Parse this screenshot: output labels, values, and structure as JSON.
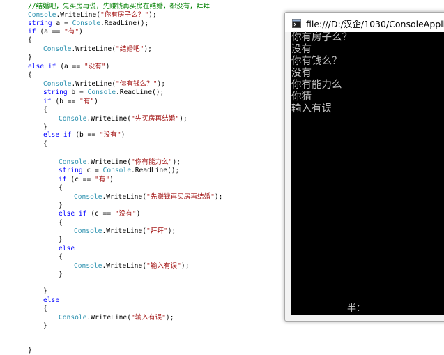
{
  "code": {
    "lines": [
      {
        "tokens": [
          {
            "t": "//结婚吧，先买房再说，先赚钱再买房在结婚，都没有，拜拜",
            "c": "cmt"
          }
        ]
      },
      {
        "tokens": [
          {
            "t": "Console",
            "c": "typ"
          },
          {
            "t": ".WriteLine(",
            "c": ""
          },
          {
            "t": "\"你有房子么？\"",
            "c": "str"
          },
          {
            "t": ");",
            "c": ""
          }
        ]
      },
      {
        "tokens": [
          {
            "t": "string",
            "c": "kw"
          },
          {
            "t": " a = ",
            "c": ""
          },
          {
            "t": "Console",
            "c": "typ"
          },
          {
            "t": ".ReadLine();",
            "c": ""
          }
        ]
      },
      {
        "tokens": [
          {
            "t": "if",
            "c": "kw"
          },
          {
            "t": " (a == ",
            "c": ""
          },
          {
            "t": "\"有\"",
            "c": "str"
          },
          {
            "t": ")",
            "c": ""
          }
        ]
      },
      {
        "tokens": [
          {
            "t": "{",
            "c": ""
          }
        ]
      },
      {
        "tokens": [
          {
            "t": "Console",
            "c": "typ"
          },
          {
            "t": ".WriteLine(",
            "c": ""
          },
          {
            "t": "\"结婚吧\"",
            "c": "str"
          },
          {
            "t": ");",
            "c": ""
          }
        ]
      },
      {
        "tokens": [
          {
            "t": "}",
            "c": ""
          }
        ]
      },
      {
        "tokens": [
          {
            "t": "else if",
            "c": "kw"
          },
          {
            "t": " (a == ",
            "c": ""
          },
          {
            "t": "\"没有\"",
            "c": "str"
          },
          {
            "t": ")",
            "c": ""
          }
        ]
      },
      {
        "tokens": [
          {
            "t": "{",
            "c": ""
          }
        ]
      },
      {
        "tokens": [
          {
            "t": "Console",
            "c": "typ"
          },
          {
            "t": ".WriteLine(",
            "c": ""
          },
          {
            "t": "\"你有钱么？\"",
            "c": "str"
          },
          {
            "t": ");",
            "c": ""
          }
        ]
      },
      {
        "tokens": [
          {
            "t": "string",
            "c": "kw"
          },
          {
            "t": " b = ",
            "c": ""
          },
          {
            "t": "Console",
            "c": "typ"
          },
          {
            "t": ".ReadLine();",
            "c": ""
          }
        ]
      },
      {
        "tokens": [
          {
            "t": "if",
            "c": "kw"
          },
          {
            "t": " (b == ",
            "c": ""
          },
          {
            "t": "\"有\"",
            "c": "str"
          },
          {
            "t": ")",
            "c": ""
          }
        ]
      },
      {
        "tokens": [
          {
            "t": "{",
            "c": ""
          }
        ]
      },
      {
        "tokens": [
          {
            "t": "Console",
            "c": "typ"
          },
          {
            "t": ".WriteLine(",
            "c": ""
          },
          {
            "t": "\"先买房再结婚\"",
            "c": "str"
          },
          {
            "t": ");",
            "c": ""
          }
        ]
      },
      {
        "tokens": [
          {
            "t": "}",
            "c": ""
          }
        ]
      },
      {
        "tokens": [
          {
            "t": "else if",
            "c": "kw"
          },
          {
            "t": " (b == ",
            "c": ""
          },
          {
            "t": "\"没有\"",
            "c": "str"
          },
          {
            "t": ")",
            "c": ""
          }
        ]
      },
      {
        "tokens": [
          {
            "t": "{",
            "c": ""
          }
        ]
      },
      {
        "tokens": [
          {
            "t": "Console",
            "c": "typ"
          },
          {
            "t": ".WriteLine(",
            "c": ""
          },
          {
            "t": "\"你有能力么\"",
            "c": "str"
          },
          {
            "t": ");",
            "c": ""
          }
        ]
      },
      {
        "tokens": [
          {
            "t": "string",
            "c": "kw"
          },
          {
            "t": " c = ",
            "c": ""
          },
          {
            "t": "Console",
            "c": "typ"
          },
          {
            "t": ".ReadLine();",
            "c": ""
          }
        ]
      },
      {
        "tokens": [
          {
            "t": "if",
            "c": "kw"
          },
          {
            "t": " (c == ",
            "c": ""
          },
          {
            "t": "\"有\"",
            "c": "str"
          },
          {
            "t": ")",
            "c": ""
          }
        ]
      },
      {
        "tokens": [
          {
            "t": "{",
            "c": ""
          }
        ]
      },
      {
        "tokens": [
          {
            "t": "Console",
            "c": "typ"
          },
          {
            "t": ".WriteLine(",
            "c": ""
          },
          {
            "t": "\"先赚钱再买房再结婚\"",
            "c": "str"
          },
          {
            "t": ");",
            "c": ""
          }
        ]
      },
      {
        "tokens": [
          {
            "t": "}",
            "c": ""
          }
        ]
      },
      {
        "tokens": [
          {
            "t": "else if",
            "c": "kw"
          },
          {
            "t": " (c == ",
            "c": ""
          },
          {
            "t": "\"没有\"",
            "c": "str"
          },
          {
            "t": ")",
            "c": ""
          }
        ]
      },
      {
        "tokens": [
          {
            "t": "{",
            "c": ""
          }
        ]
      },
      {
        "tokens": [
          {
            "t": "Console",
            "c": "typ"
          },
          {
            "t": ".WriteLine(",
            "c": ""
          },
          {
            "t": "\"拜拜\"",
            "c": "str"
          },
          {
            "t": ");",
            "c": ""
          }
        ]
      },
      {
        "tokens": [
          {
            "t": "}",
            "c": ""
          }
        ]
      },
      {
        "tokens": [
          {
            "t": "else",
            "c": "kw"
          }
        ]
      },
      {
        "tokens": [
          {
            "t": "{",
            "c": ""
          }
        ]
      },
      {
        "tokens": [
          {
            "t": "Console",
            "c": "typ"
          },
          {
            "t": ".WriteLine(",
            "c": ""
          },
          {
            "t": "\"输入有误\"",
            "c": "str"
          },
          {
            "t": ");",
            "c": ""
          }
        ]
      },
      {
        "tokens": [
          {
            "t": "}",
            "c": ""
          }
        ]
      },
      {
        "tokens": [
          {
            "t": "}",
            "c": ""
          }
        ]
      },
      {
        "tokens": [
          {
            "t": "else",
            "c": "kw"
          }
        ]
      },
      {
        "tokens": [
          {
            "t": "{",
            "c": ""
          }
        ]
      },
      {
        "tokens": [
          {
            "t": "Console",
            "c": "typ"
          },
          {
            "t": ".WriteLine(",
            "c": ""
          },
          {
            "t": "\"输入有误\"",
            "c": "str"
          },
          {
            "t": ");",
            "c": ""
          }
        ]
      },
      {
        "tokens": [
          {
            "t": "}",
            "c": ""
          }
        ]
      },
      {
        "tokens": [
          {
            "t": "}",
            "c": ""
          }
        ]
      }
    ]
  },
  "console_window": {
    "title": "file:///D:/汉企/1030/ConsoleApplic",
    "icon": "console-app-icon",
    "output_lines": [
      "你有房子么？",
      "没有",
      "你有钱么？",
      "没有",
      "你有能力么",
      "你猜",
      "输入有误"
    ],
    "ime_indicator": "半："
  },
  "colors": {
    "comment": "#008000",
    "keyword": "#0000ff",
    "type": "#2b91af",
    "string": "#a31515",
    "console_background": "#000000",
    "console_text": "#c0c0c0"
  }
}
